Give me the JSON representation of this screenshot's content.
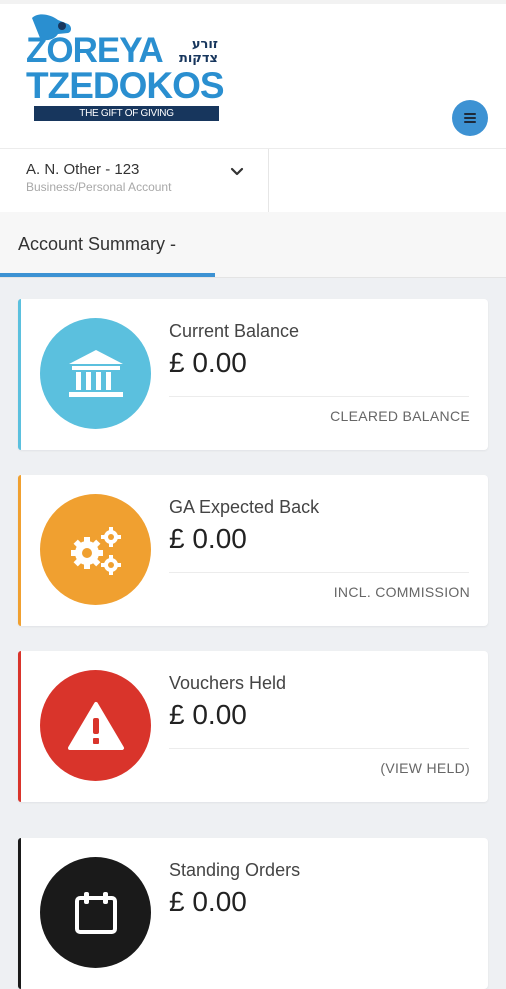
{
  "header": {
    "logo_line1": "ZOREYA",
    "logo_hebrew": "זורע צדקות",
    "logo_line2": "TZEDOKOS",
    "logo_tagline": "THE GIFT OF GIVING",
    "brand_color": "#2a8fd0",
    "navy_color": "#17365d"
  },
  "account": {
    "name": "A. N. Other - 123",
    "type": "Business/Personal Account"
  },
  "summary": {
    "title": "Account Summary -"
  },
  "cards": [
    {
      "title": "Current Balance",
      "amount": "£ 0.00",
      "footer": "CLEARED BALANCE",
      "color": "#5bc0de",
      "icon": "bank-icon"
    },
    {
      "title": "GA Expected Back",
      "amount": "£ 0.00",
      "footer": "INCL. COMMISSION",
      "color": "#f0a030",
      "icon": "gears-icon"
    },
    {
      "title": "Vouchers Held",
      "amount": "£ 0.00",
      "footer": "(VIEW HELD)",
      "color": "#d9342b",
      "icon": "warning-icon"
    },
    {
      "title": "Standing Orders",
      "amount": "£ 0.00",
      "footer": "",
      "color": "#1a1a1a",
      "icon": "calendar-icon"
    }
  ]
}
